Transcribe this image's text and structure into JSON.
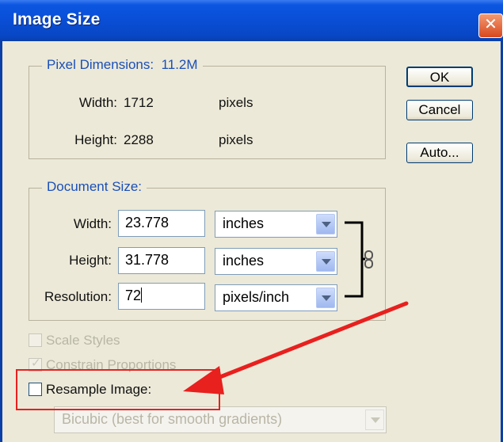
{
  "window": {
    "title": "Image Size"
  },
  "pixel_dimensions": {
    "legend": "Pixel Dimensions:",
    "size": "11.2M",
    "width_label": "Width:",
    "width_value": "1712",
    "width_unit": "pixels",
    "height_label": "Height:",
    "height_value": "2288",
    "height_unit": "pixels"
  },
  "buttons": {
    "ok": "OK",
    "cancel": "Cancel",
    "auto": "Auto..."
  },
  "document_size": {
    "legend": "Document Size:",
    "width_label": "Width:",
    "width_value": "23.778",
    "width_unit": "inches",
    "height_label": "Height:",
    "height_value": "31.778",
    "height_unit": "inches",
    "resolution_label": "Resolution:",
    "resolution_value": "72",
    "resolution_unit": "pixels/inch"
  },
  "options": {
    "scale_styles": "Scale Styles",
    "constrain_proportions": "Constrain Proportions",
    "resample_image": "Resample Image:",
    "resample_method": "Bicubic (best for smooth gradients)"
  },
  "colors": {
    "annotation": "#e8201e",
    "title_bar": "#0a4fd8",
    "legend_text": "#1a4fb8"
  },
  "icons": [
    "close-icon",
    "chain-link-icon",
    "chevron-down-icon",
    "annotation-arrow"
  ]
}
